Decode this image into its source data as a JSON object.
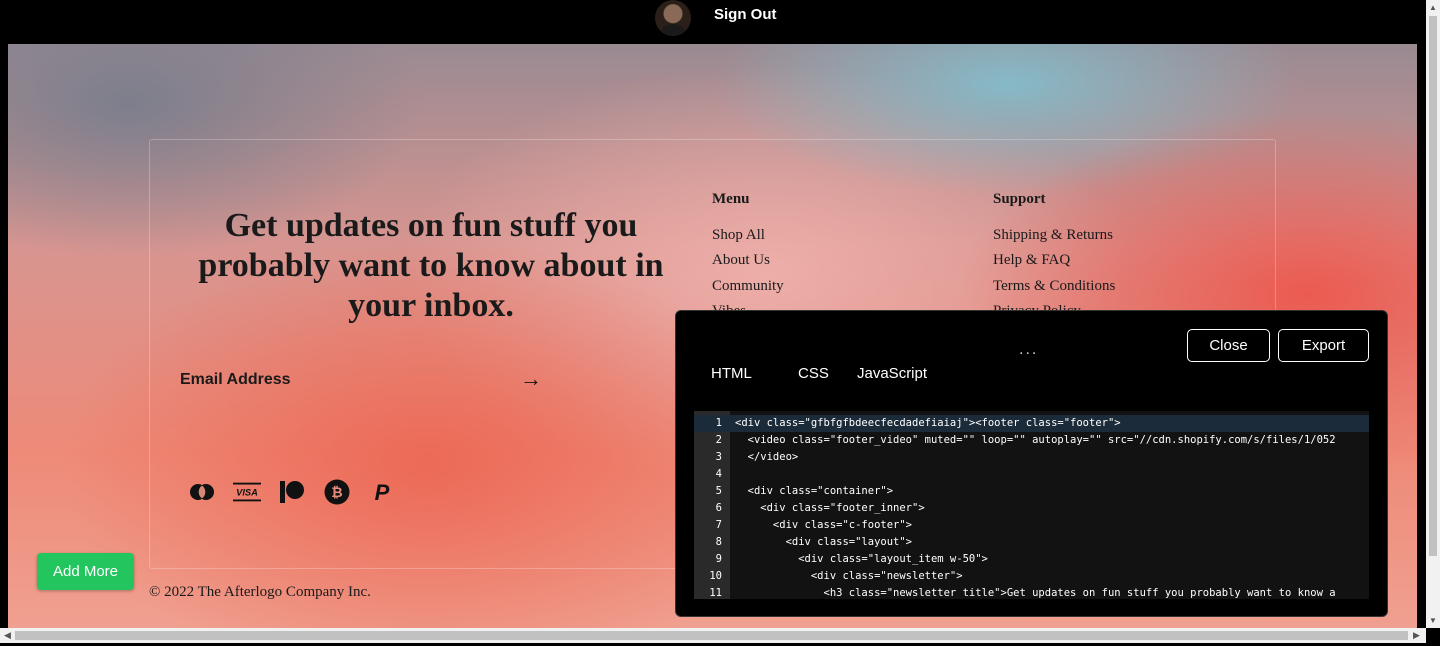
{
  "topbar": {
    "sign_out": "Sign Out"
  },
  "newsletter": {
    "title": "Get updates on fun stuff you probably want to know about in your inbox.",
    "email_label": "Email Address",
    "submit_arrow": "→"
  },
  "menu": {
    "title": "Menu",
    "items": [
      "Shop All",
      "About Us",
      "Community",
      "Vibes"
    ]
  },
  "support": {
    "title": "Support",
    "items": [
      "Shipping & Returns",
      "Help & FAQ",
      "Terms & Conditions",
      "Privacy Policy"
    ]
  },
  "payment_icons": [
    "mastercard-icon",
    "visa-icon",
    "patreon-icon",
    "bitcoin-icon",
    "paypal-icon"
  ],
  "copyright": "© 2022 The Afterlogo Company Inc.",
  "add_more": "Add More",
  "code_panel": {
    "dots": "...",
    "tabs": [
      "HTML",
      "CSS",
      "JavaScript"
    ],
    "close_label": "Close",
    "export_label": "Export",
    "lines": [
      {
        "num": "1",
        "code": "<div class=\"gfbfgfbdeecfecdadefiaiaj\"><footer class=\"footer\">"
      },
      {
        "num": "2",
        "code": "  <video class=\"footer_video\" muted=\"\" loop=\"\" autoplay=\"\" src=\"//cdn.shopify.com/s/files/1/052"
      },
      {
        "num": "3",
        "code": "  </video>"
      },
      {
        "num": "4",
        "code": ""
      },
      {
        "num": "5",
        "code": "  <div class=\"container\">"
      },
      {
        "num": "6",
        "code": "    <div class=\"footer_inner\">"
      },
      {
        "num": "7",
        "code": "      <div class=\"c-footer\">"
      },
      {
        "num": "8",
        "code": "        <div class=\"layout\">"
      },
      {
        "num": "9",
        "code": "          <div class=\"layout_item w-50\">"
      },
      {
        "num": "10",
        "code": "            <div class=\"newsletter\">"
      },
      {
        "num": "11",
        "code": "              <h3 class=\"newsletter title\">Get updates on fun stuff you probably want to know a"
      }
    ]
  },
  "colors": {
    "add_more_bg": "#22c55e",
    "panel_bg": "#000000",
    "active_line": "#1c2b3a"
  }
}
